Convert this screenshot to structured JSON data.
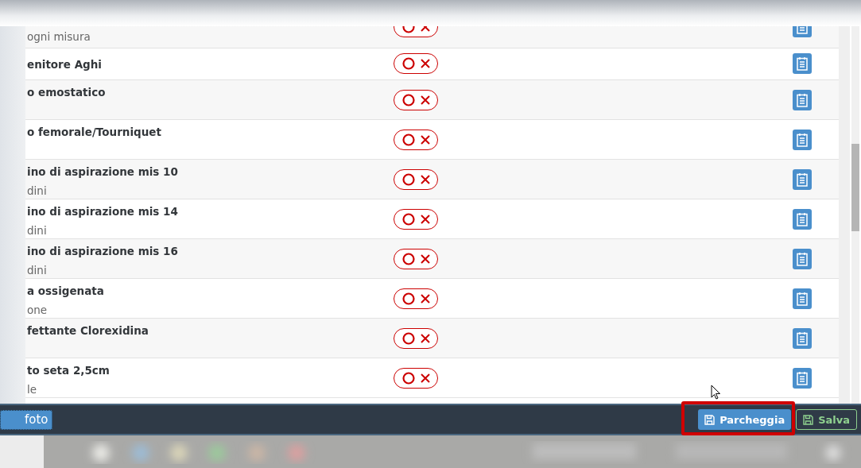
{
  "rows": [
    {
      "kind": "partial",
      "title": "",
      "subtitle": "ogni misura",
      "checked": false
    },
    {
      "kind": "compact",
      "title": "enitore Aghi",
      "checked": false
    },
    {
      "kind": "full",
      "title": "o emostatico",
      "checked": false
    },
    {
      "kind": "full",
      "title": "o femorale/Tourniquet",
      "checked": false
    },
    {
      "kind": "full",
      "title": "ino di aspirazione mis 10",
      "subtitle": "dini",
      "checked": false
    },
    {
      "kind": "full",
      "title": "ino di aspirazione mis 14",
      "subtitle": "dini",
      "checked": false
    },
    {
      "kind": "full",
      "title": "ino di aspirazione mis 16",
      "subtitle": "dini",
      "checked": false
    },
    {
      "kind": "full",
      "title": "a ossigenata",
      "subtitle": "one",
      "checked": false
    },
    {
      "kind": "full",
      "title": "fettante Clorexidina",
      "checked": false
    },
    {
      "kind": "full",
      "title": "to seta 2,5cm",
      "subtitle": "le",
      "checked": false
    }
  ],
  "footer": {
    "left_button": "foto",
    "buttons": [
      {
        "kind": "primary",
        "label": "Parcheggia",
        "highlighted": true
      },
      {
        "kind": "outline",
        "label": "Salva",
        "highlighted": false
      }
    ]
  }
}
